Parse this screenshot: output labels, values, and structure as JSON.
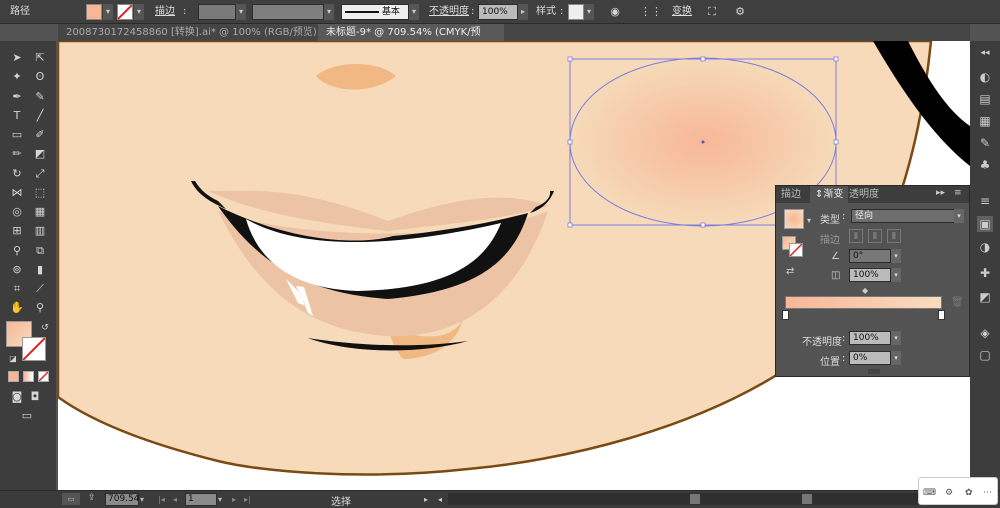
{
  "control_bar": {
    "object_type": "路径",
    "stroke_label": "描边",
    "stroke_style": "基本",
    "opacity_label": "不透明度",
    "opacity_value": "100%",
    "style_label": "样式",
    "transform_label": "变换",
    "fill_color": "#f7b797"
  },
  "tabs": [
    {
      "title": "2008730172458860 [转换].ai* @ 100% (RGB/预览)"
    },
    {
      "title": "未标题-9* @ 709.54% (CMYK/预览)",
      "active": true
    }
  ],
  "gradient_panel": {
    "tabs": [
      "描边",
      "渐变",
      "透明度"
    ],
    "active_tab": "渐变",
    "type_label": "类型",
    "type_value": "径向",
    "stroke_label": "描边",
    "angle_value": "0°",
    "aspect_value": "100%",
    "opacity_label": "不透明度",
    "opacity_value": "100%",
    "position_label": "位置",
    "position_value": "0%",
    "gradient_start": "#f7b797",
    "gradient_end": "#f8dcc0"
  },
  "status_bar": {
    "zoom": "709.54",
    "page": "1",
    "mode": "选择"
  },
  "colors": {
    "skin": "#f6dab9",
    "outline": "#7a4a12",
    "blush": "#f7b797"
  }
}
